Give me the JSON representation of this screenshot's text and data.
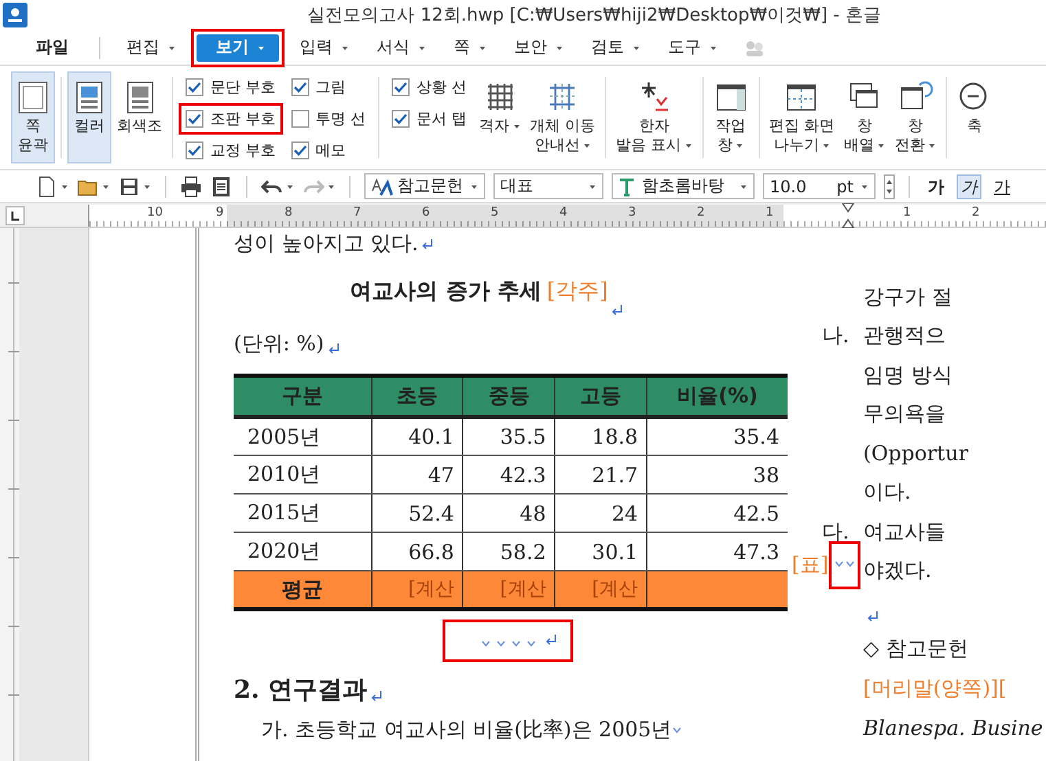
{
  "window": {
    "title": "실전모의고사 12회.hwp [C:₩Users₩hiji2₩Desktop₩이것₩] - 혼글"
  },
  "menu": [
    {
      "label": "파일",
      "has_dropdown": false,
      "selected": false,
      "highlighted": false
    },
    {
      "label": "편집",
      "has_dropdown": true,
      "selected": false,
      "highlighted": false
    },
    {
      "label": "보기",
      "has_dropdown": true,
      "selected": true,
      "highlighted": true
    },
    {
      "label": "입력",
      "has_dropdown": true,
      "selected": false,
      "highlighted": false
    },
    {
      "label": "서식",
      "has_dropdown": true,
      "selected": false,
      "highlighted": false
    },
    {
      "label": "쪽",
      "has_dropdown": true,
      "selected": false,
      "highlighted": false
    },
    {
      "label": "보안",
      "has_dropdown": true,
      "selected": false,
      "highlighted": false
    },
    {
      "label": "검토",
      "has_dropdown": true,
      "selected": false,
      "highlighted": false
    },
    {
      "label": "도구",
      "has_dropdown": true,
      "selected": false,
      "highlighted": false
    }
  ],
  "ribbon": [
    {
      "kind": "big",
      "label": "쪽\n윤곽",
      "selected": true,
      "has_dropdown": false
    },
    {
      "kind": "sep"
    },
    {
      "kind": "big",
      "label": "컬러",
      "selected": true,
      "has_dropdown": false
    },
    {
      "kind": "big",
      "label": "회색조",
      "selected": false,
      "has_dropdown": false
    },
    {
      "kind": "sep"
    },
    {
      "kind": "checks",
      "items": [
        {
          "label": "문단 부호",
          "checked": true,
          "highlighted": false
        },
        {
          "label": "조판 부호",
          "checked": true,
          "highlighted": true
        },
        {
          "label": "교정 부호",
          "checked": true,
          "highlighted": false
        }
      ]
    },
    {
      "kind": "checks",
      "items": [
        {
          "label": "그림",
          "checked": true,
          "highlighted": false
        },
        {
          "label": "투명 선",
          "checked": false,
          "highlighted": false
        },
        {
          "label": "메모",
          "checked": true,
          "highlighted": false
        }
      ]
    },
    {
      "kind": "sep"
    },
    {
      "kind": "checks",
      "items": [
        {
          "label": "상황 선",
          "checked": true,
          "highlighted": false
        },
        {
          "label": "문서 탭",
          "checked": true,
          "highlighted": false
        }
      ]
    },
    {
      "kind": "big",
      "label": "격자",
      "selected": false,
      "has_dropdown": true
    },
    {
      "kind": "big",
      "label": "개체 이동\n안내선",
      "selected": false,
      "has_dropdown": true
    },
    {
      "kind": "sep"
    },
    {
      "kind": "big",
      "label": "한자\n발음 표시",
      "selected": false,
      "has_dropdown": true
    },
    {
      "kind": "sep"
    },
    {
      "kind": "big",
      "label": "작업\n창",
      "selected": false,
      "has_dropdown": true
    },
    {
      "kind": "sep"
    },
    {
      "kind": "big",
      "label": "편집 화면\n나누기",
      "selected": false,
      "has_dropdown": true
    },
    {
      "kind": "big",
      "label": "창\n배열",
      "selected": false,
      "has_dropdown": true
    },
    {
      "kind": "big",
      "label": "창\n전환",
      "selected": false,
      "has_dropdown": true
    },
    {
      "kind": "sep"
    },
    {
      "kind": "big",
      "label": "축",
      "selected": false,
      "has_dropdown": false
    }
  ],
  "toolbar": {
    "style": "참고문헌",
    "outline": "대표",
    "font": "함초롬바탕",
    "size": "10.0",
    "unit": "pt",
    "format_buttons": [
      {
        "label": "가",
        "kind": "bold",
        "selected": false
      },
      {
        "label": "가",
        "kind": "italic",
        "selected": true
      },
      {
        "label": "가",
        "kind": "underline",
        "selected": false
      }
    ]
  },
  "ruler": {
    "labels": [
      "10",
      "9",
      "8",
      "7",
      "6",
      "5",
      "4",
      "3",
      "2",
      "1",
      "1",
      "2"
    ]
  },
  "document": {
    "left_column": [
      {
        "kind": "text",
        "text": "성이 높아지고 있다."
      },
      {
        "kind": "title",
        "text": "여교사의 증가 추세",
        "note": "[각주]"
      },
      {
        "kind": "text",
        "text": "(단위: %)"
      },
      {
        "kind": "table",
        "columns": [
          "구분",
          "초등",
          "중등",
          "고등",
          "비율(%)"
        ],
        "rows": [
          [
            "2005년",
            "40.1",
            "35.5",
            "18.8",
            "35.4"
          ],
          [
            "2010년",
            "47",
            "42.3",
            "21.7",
            "38"
          ],
          [
            "2015년",
            "52.4",
            "48",
            "24",
            "42.5"
          ],
          [
            "2020년",
            "66.8",
            "58.2",
            "30.1",
            "47.3"
          ]
        ],
        "total_row": [
          "평균",
          "[계산",
          "[계산",
          "[계산"
        ],
        "side_code": "[표]",
        "side_highlighted": true
      },
      {
        "kind": "blank",
        "highlighted": true
      },
      {
        "kind": "heading",
        "text": "2. 연구결과"
      },
      {
        "kind": "list_item",
        "text": "가. 초등학교  여교사의  비율(比率)은  2005년"
      }
    ],
    "right_column": [
      {
        "kind": "text",
        "text": "강구가 절"
      },
      {
        "kind": "list_item",
        "prefix": "나.",
        "text": "관행적으"
      },
      {
        "kind": "text",
        "text": "임명 방식"
      },
      {
        "kind": "text",
        "text": "무의욕을"
      },
      {
        "kind": "text",
        "text": "(Opportur"
      },
      {
        "kind": "text",
        "text": "이다."
      },
      {
        "kind": "list_item",
        "prefix": "다.",
        "text": "여교사들"
      },
      {
        "kind": "text",
        "text": "야겠다."
      },
      {
        "kind": "blank"
      },
      {
        "kind": "text",
        "text": "◇ 참고문헌"
      },
      {
        "kind": "code",
        "text": "[머리말(양쪽)]["
      },
      {
        "kind": "reference",
        "text": "Blanespa. Busine"
      }
    ]
  }
}
